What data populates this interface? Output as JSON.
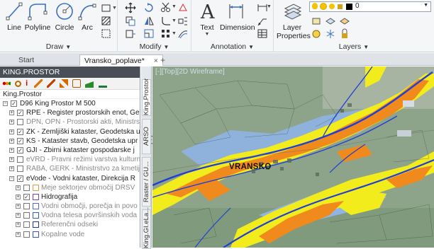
{
  "ribbon": {
    "draw": {
      "title": "Draw",
      "tools": [
        {
          "label": "Line",
          "icon": "line-icon"
        },
        {
          "label": "Polyline",
          "icon": "polyline-icon"
        },
        {
          "label": "Circle",
          "icon": "circle-icon"
        },
        {
          "label": "Arc",
          "icon": "arc-icon"
        }
      ]
    },
    "modify": {
      "title": "Modify"
    },
    "annotation": {
      "title": "Annotation",
      "tools": [
        {
          "label": "Text",
          "icon": "text-icon"
        },
        {
          "label": "Dimension",
          "icon": "dimension-icon"
        }
      ]
    },
    "layers": {
      "title": "Layers",
      "layer_properties_line1": "Layer",
      "layer_properties_line2": "Properties",
      "current_layer": "0"
    }
  },
  "tabs": [
    {
      "label": "Start"
    },
    {
      "label": "Vransko_poplave*"
    }
  ],
  "palette": {
    "title": "KING.PROSTOR",
    "root_label": "King.Prostor",
    "rows": [
      {
        "text": "D96 King Prostor M 500",
        "checked": true,
        "expand": "−",
        "level": 0
      },
      {
        "text": "RPE - Register prostorskih enot, Ge",
        "checked": true,
        "expand": "+",
        "level": 1
      },
      {
        "text": "DPN, OPN - Prostorski akti, Ministrstv",
        "checked": false,
        "expand": "+",
        "level": 1,
        "dim": true
      },
      {
        "text": "ZK - Zemljiški kataster, Geodetska up",
        "checked": true,
        "expand": "+",
        "level": 1
      },
      {
        "text": "KS - Kataster stavb, Geodetska upr",
        "checked": true,
        "expand": "+",
        "level": 1
      },
      {
        "text": "GJI - Zbirni kataster gospodarske j",
        "checked": true,
        "expand": "+",
        "level": 1
      },
      {
        "text": "eVRD - Pravni režimi varstva kulturne",
        "checked": false,
        "expand": "+",
        "level": 1,
        "dim": true
      },
      {
        "text": "RABA, GERK - Ministrstvo za kmetijst",
        "checked": false,
        "expand": "+",
        "level": 1,
        "dim": true
      },
      {
        "text": "eVode - Vodni kataster, Direkcija R",
        "checked": true,
        "expand": "−",
        "level": 1
      },
      {
        "text": "Meje sektorjev območij DRSV",
        "checked": false,
        "expand": "+",
        "level": 2,
        "dim": true,
        "sym": "#d9a24a"
      },
      {
        "text": "Hidrografija",
        "checked": true,
        "expand": "+",
        "level": 2,
        "sym": "#7a3fb0"
      },
      {
        "text": "Vodni območji, porečja in povo",
        "checked": false,
        "expand": "+",
        "level": 2,
        "dim": true,
        "sym": "#4a6fd6"
      },
      {
        "text": "Vodna telesa površinskih voda",
        "checked": false,
        "expand": "+",
        "level": 2,
        "dim": true,
        "sym": "#2b5fd0"
      },
      {
        "text": "Referenčni odseki",
        "checked": false,
        "expand": "+",
        "level": 2,
        "dim": true,
        "sym": "#1a3a9a"
      },
      {
        "text": "Kopalne vode",
        "checked": false,
        "expand": "+",
        "level": 2,
        "dim": true,
        "sym": "#3355cc"
      }
    ]
  },
  "sidetabs": [
    {
      "label": "King.Prostor"
    },
    {
      "label": "ARSO Lidar"
    },
    {
      "label": "Raster / GU..."
    },
    {
      "label": "King.GI.eLa..."
    }
  ],
  "map": {
    "viewport_label": "[-][Top][2D Wireframe]",
    "place_name": "VRANSKO"
  },
  "colors": {
    "flood_yellow": "#f2ec1c",
    "flood_orange": "#f08a1c",
    "water_blue": "#8fb4e6",
    "river": "#1f3fd6",
    "terrain": "#8fa38a"
  }
}
